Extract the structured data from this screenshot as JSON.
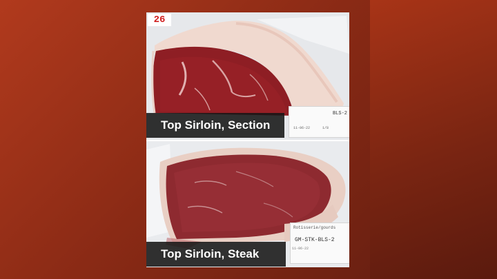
{
  "photos": {
    "top": {
      "caption": "Top Sirloin, Section",
      "sample_number": "26",
      "label_line1": "BLS-2",
      "label_line2": "11-06-22",
      "label_line3": "1/8"
    },
    "bottom": {
      "caption": "Top Sirloin, Steak",
      "label_line1": "Rotisserie/gourds",
      "label_line2": "GM-STK-BLS-2",
      "label_line3": "11-06-22"
    }
  },
  "colors": {
    "background_red": "#b13a1d",
    "meat_red": "#8e1e24",
    "caption_bg": "#161616"
  }
}
